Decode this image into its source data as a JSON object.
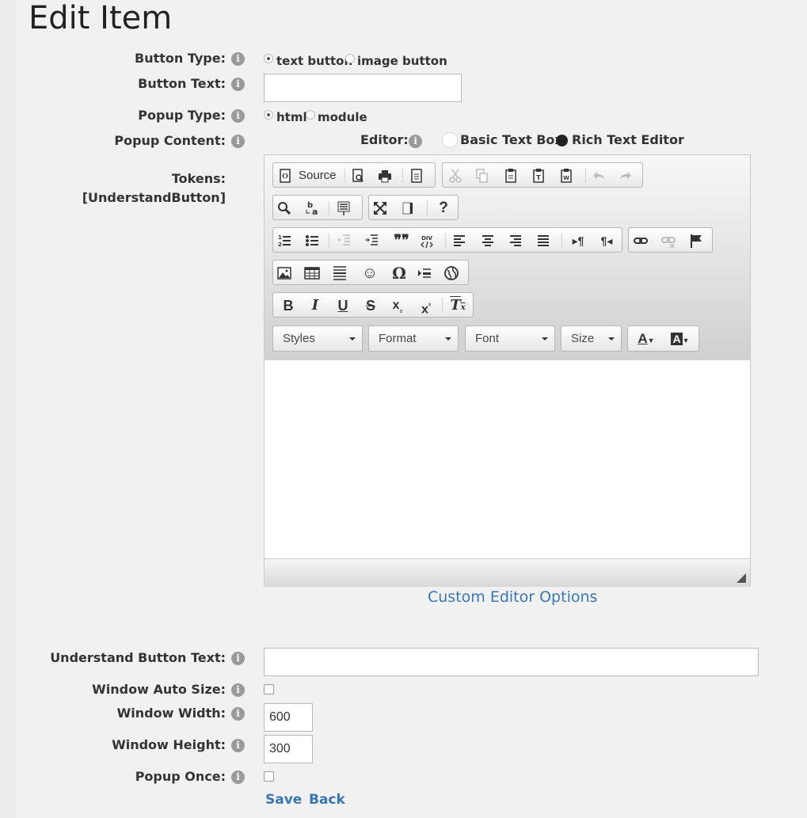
{
  "page": {
    "title": "Edit Item"
  },
  "fields": {
    "button_type": {
      "label": "Button Type:",
      "options": [
        "text button",
        "image button"
      ],
      "selected": "text button"
    },
    "button_text": {
      "label": "Button Text:",
      "value": ""
    },
    "popup_type": {
      "label": "Popup Type:",
      "options": [
        "html",
        "module"
      ],
      "selected": "html"
    },
    "popup_content": {
      "label": "Popup Content:"
    },
    "editor_choice": {
      "label": "Editor:",
      "options": [
        "Basic Text Box",
        "Rich Text Editor"
      ],
      "selected": "Rich Text Editor"
    },
    "tokens": {
      "label": "Tokens:",
      "value": "[UnderstandButton]"
    },
    "understand_button_text": {
      "label": "Understand Button Text:",
      "value": ""
    },
    "window_auto_size": {
      "label": "Window Auto Size:",
      "checked": false
    },
    "window_width": {
      "label": "Window Width:",
      "value": "600"
    },
    "window_height": {
      "label": "Window Height:",
      "value": "300"
    },
    "popup_once": {
      "label": "Popup Once:",
      "checked": false
    }
  },
  "editor": {
    "source_label": "Source",
    "combos": {
      "styles": "Styles",
      "format": "Format",
      "font": "Font",
      "size": "Size"
    },
    "text_color_glyph": "A",
    "bg_color_glyph": "A",
    "custom_options_link": "Custom Editor Options"
  },
  "actions": {
    "save": "Save",
    "back": "Back"
  },
  "info_glyph": "i"
}
